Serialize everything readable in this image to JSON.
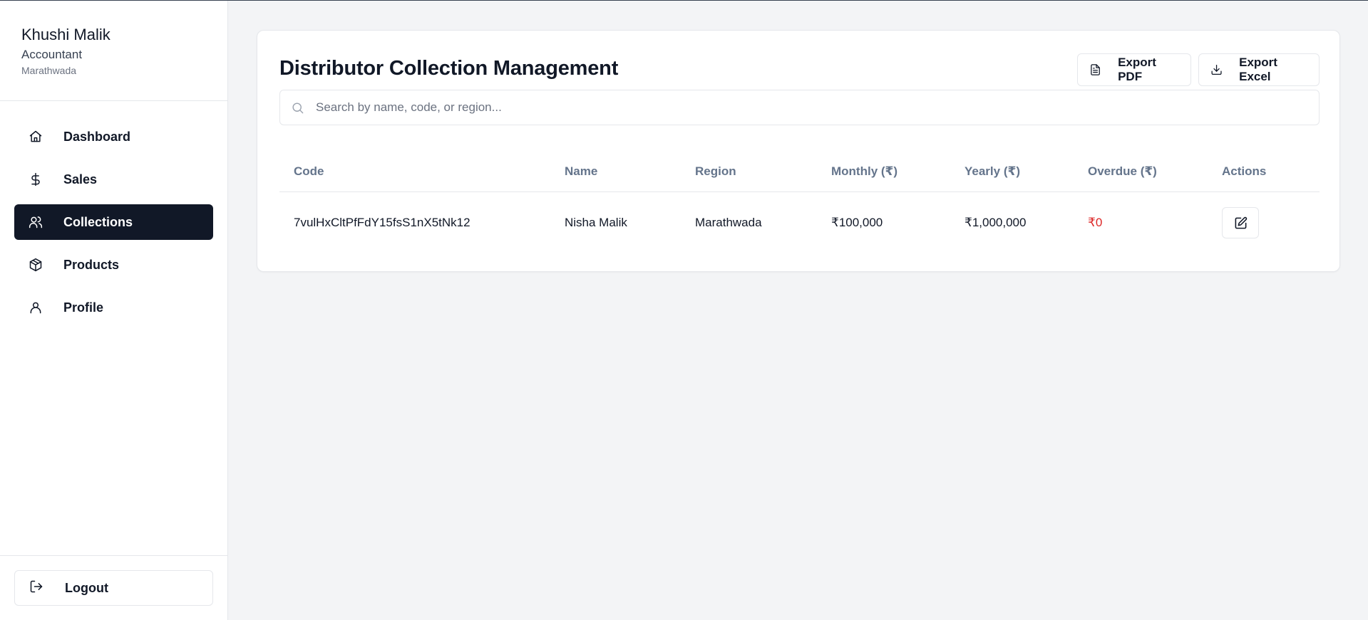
{
  "user": {
    "name": "Khushi Malik",
    "role": "Accountant",
    "region": "Marathwada"
  },
  "sidebar": {
    "items": [
      {
        "label": "Dashboard",
        "icon": "home-icon",
        "active": false
      },
      {
        "label": "Sales",
        "icon": "dollar-icon",
        "active": false
      },
      {
        "label": "Collections",
        "icon": "users-icon",
        "active": true
      },
      {
        "label": "Products",
        "icon": "box-icon",
        "active": false
      },
      {
        "label": "Profile",
        "icon": "user-icon",
        "active": false
      }
    ],
    "logout_label": "Logout"
  },
  "main": {
    "title": "Distributor Collection Management",
    "export_pdf_label": "Export PDF",
    "export_excel_label": "Export Excel",
    "search": {
      "placeholder": "Search by name, code, or region...",
      "value": ""
    },
    "table": {
      "headers": [
        "Code",
        "Name",
        "Region",
        "Monthly (₹)",
        "Yearly (₹)",
        "Overdue (₹)",
        "Actions"
      ],
      "rows": [
        {
          "code": "7vulHxCltPfFdY15fsS1nX5tNk12",
          "name": "Nisha Malik",
          "region": "Marathwada",
          "monthly": "₹100,000",
          "yearly": "₹1,000,000",
          "overdue": "₹0"
        }
      ]
    }
  },
  "colors": {
    "active_nav_bg": "#111827",
    "overdue_text": "#dc2626",
    "page_bg": "#f3f4f6"
  }
}
